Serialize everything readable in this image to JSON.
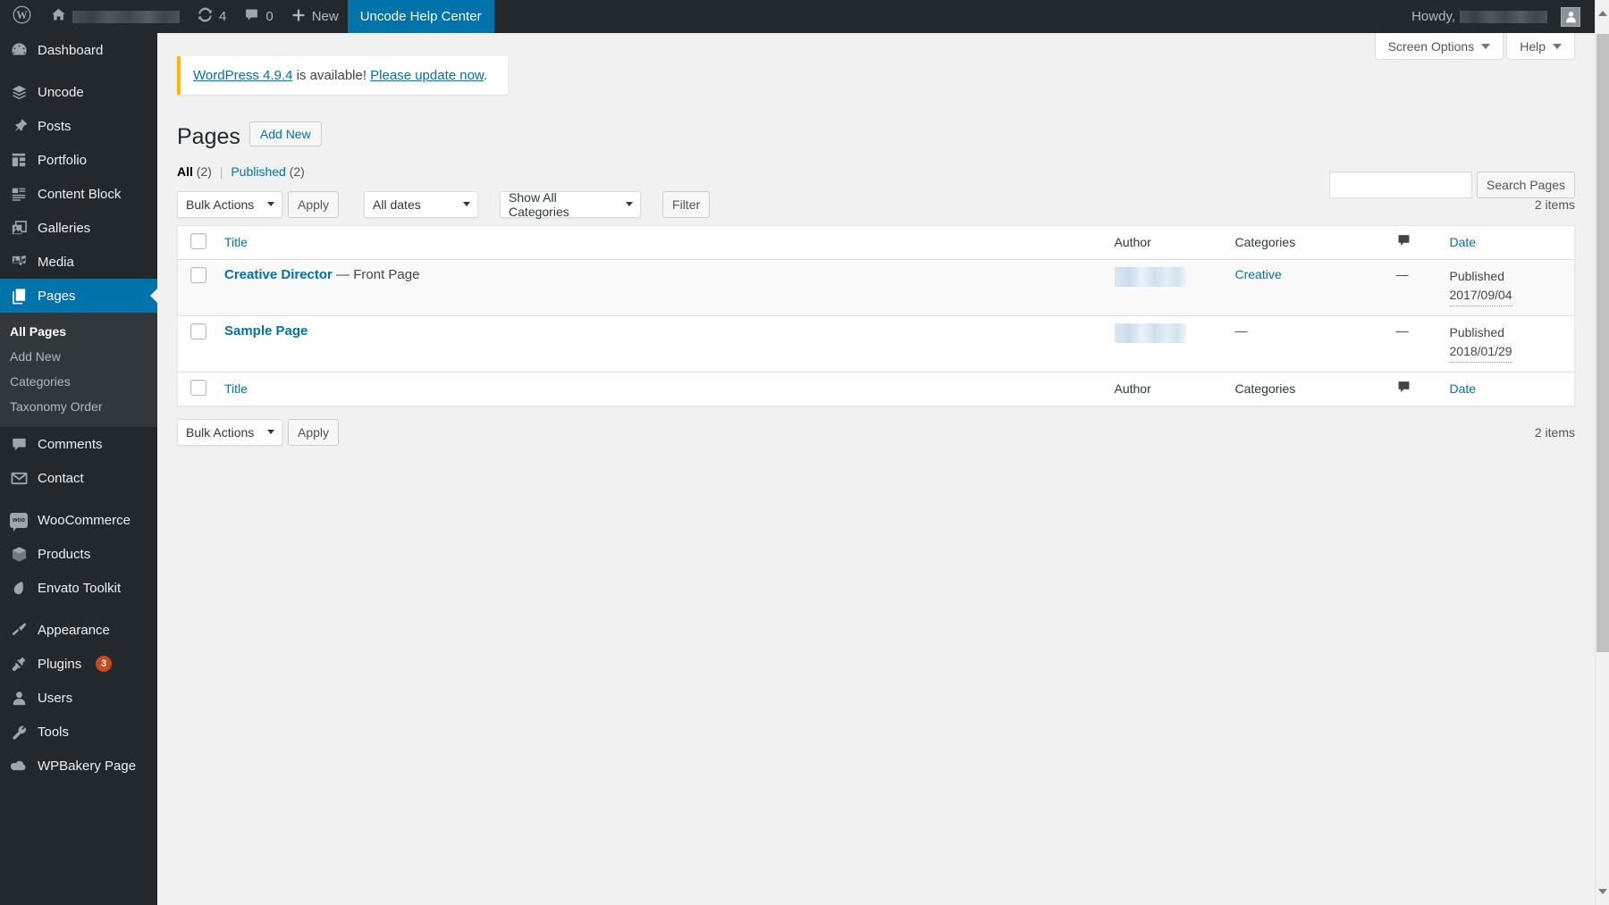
{
  "adminbar": {
    "wp_logo": "wordpress-logo",
    "home_icon": "home-icon",
    "site_name_redacted": true,
    "updates_icon": "updates-icon",
    "updates_count": "4",
    "comments_icon": "comments-icon",
    "comments_count": "0",
    "new_label": "New",
    "help_center_label": "Uncode Help Center",
    "howdy_label": "Howdy,",
    "user_redacted": true
  },
  "sidebar": {
    "items": [
      {
        "label": "Dashboard",
        "icon": "dashboard-icon"
      },
      {
        "label": "Uncode",
        "icon": "layers-icon"
      },
      {
        "label": "Posts",
        "icon": "pin-icon"
      },
      {
        "label": "Portfolio",
        "icon": "portfolio-grid-icon"
      },
      {
        "label": "Content Block",
        "icon": "content-block-icon"
      },
      {
        "label": "Galleries",
        "icon": "galleries-icon"
      },
      {
        "label": "Media",
        "icon": "media-icon"
      },
      {
        "label": "Pages",
        "icon": "pages-icon",
        "current": true
      },
      {
        "label": "Comments",
        "icon": "comment-icon"
      },
      {
        "label": "Contact",
        "icon": "envelope-icon"
      },
      {
        "label": "WooCommerce",
        "icon": "woocommerce-icon"
      },
      {
        "label": "Products",
        "icon": "box-icon"
      },
      {
        "label": "Envato Toolkit",
        "icon": "envato-leaf-icon"
      },
      {
        "label": "Appearance",
        "icon": "paintbrush-icon"
      },
      {
        "label": "Plugins",
        "icon": "plug-icon",
        "badge": "3"
      },
      {
        "label": "Users",
        "icon": "user-icon"
      },
      {
        "label": "Tools",
        "icon": "wrench-icon"
      },
      {
        "label": "WPBakery Page",
        "icon": "wpbakery-icon"
      }
    ],
    "submenu": [
      {
        "label": "All Pages",
        "current": true
      },
      {
        "label": "Add New"
      },
      {
        "label": "Categories"
      },
      {
        "label": "Taxonomy Order"
      }
    ]
  },
  "screen_meta": {
    "screen_options": "Screen Options",
    "help": "Help"
  },
  "notice": {
    "version_link": "WordPress 4.9.4",
    "middle_text": " is available! ",
    "update_link": "Please update now",
    "end_text": "."
  },
  "header": {
    "title": "Pages",
    "add_new": "Add New"
  },
  "views": {
    "all_label": "All",
    "all_count": "(2)",
    "divider": "|",
    "published_label": "Published",
    "published_count": "(2)"
  },
  "search": {
    "value": "",
    "placeholder": "",
    "button": "Search Pages"
  },
  "tablenav_top": {
    "bulk_actions": "Bulk Actions",
    "apply": "Apply",
    "all_dates": "All dates",
    "show_all_categories": "Show All Categories",
    "filter": "Filter",
    "items": "2 items"
  },
  "tablenav_bottom": {
    "bulk_actions": "Bulk Actions",
    "apply": "Apply",
    "items": "2 items"
  },
  "table": {
    "columns": {
      "title": "Title",
      "author": "Author",
      "categories": "Categories",
      "comments": "comment-bubble-icon",
      "date": "Date"
    },
    "rows": [
      {
        "title": "Creative Director",
        "title_suffix": " — Front Page",
        "author_redacted": true,
        "categories": "Creative",
        "categories_is_link": true,
        "comments": "—",
        "date_status": "Published",
        "date_value": "2017/09/04"
      },
      {
        "title": "Sample Page",
        "title_suffix": "",
        "author_redacted": true,
        "categories": "—",
        "categories_is_link": false,
        "comments": "—",
        "date_status": "Published",
        "date_value": "2018/01/29"
      }
    ]
  },
  "colors": {
    "admin_bar": "#23282d",
    "sidebar": "#23282d",
    "submenu": "#32373c",
    "accent_blue": "#0073aa",
    "notice_bar": "#ffb900",
    "badge_orange": "#ca4a1f",
    "page_bg": "#f1f1f1"
  }
}
